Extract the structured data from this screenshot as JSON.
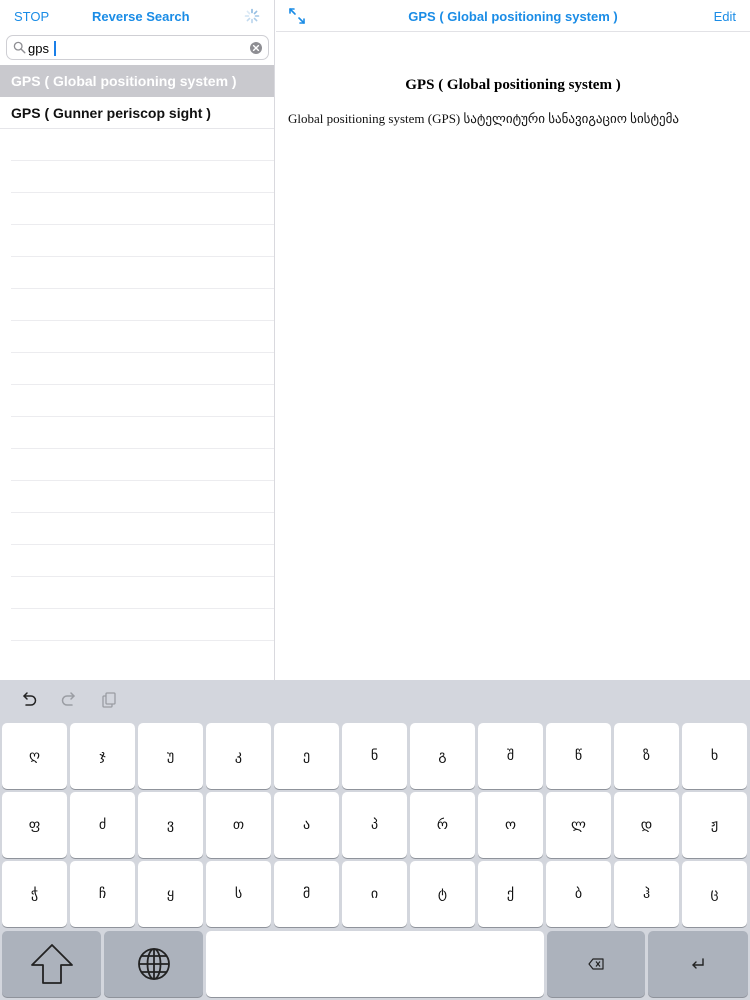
{
  "left_header": {
    "stop_label": "STOP",
    "reverse_search_label": "Reverse Search"
  },
  "search": {
    "value": "gps",
    "placeholder": ""
  },
  "results": [
    {
      "label": "GPS ( Global positioning system )",
      "selected": true
    },
    {
      "label": "GPS ( Gunner periscop sight )",
      "selected": false
    }
  ],
  "right_header": {
    "title": "GPS ( Global positioning system )",
    "edit_label": "Edit"
  },
  "detail": {
    "heading": "GPS ( Global positioning system )",
    "body": "Global positioning system (GPS) სატელიტური სანავიგაციო სისტემა"
  },
  "keyboard": {
    "row1": [
      "ღ",
      "ჯ",
      "უ",
      "კ",
      "ე",
      "ნ",
      "გ",
      "შ",
      "წ",
      "ზ",
      "ხ"
    ],
    "row2": [
      "ფ",
      "ძ",
      "ვ",
      "თ",
      "ა",
      "პ",
      "რ",
      "ო",
      "ლ",
      "დ",
      "ჟ"
    ],
    "row3": [
      "ჭ",
      "ჩ",
      "ყ",
      "ს",
      "მ",
      "ი",
      "ტ",
      "ქ",
      "ბ",
      "ჰ",
      "ც"
    ]
  },
  "colors": {
    "accent": "#1a8ce6",
    "selected_row": "#c9c9ce",
    "keyboard_bg": "#d3d6dd",
    "key_dark": "#acb2bc"
  },
  "icons": [
    "spinner-icon",
    "search-icon",
    "clear-icon",
    "expand-icon",
    "undo-icon",
    "redo-icon",
    "paste-icon",
    "shift-icon",
    "globe-icon",
    "delete-icon",
    "return-icon"
  ]
}
